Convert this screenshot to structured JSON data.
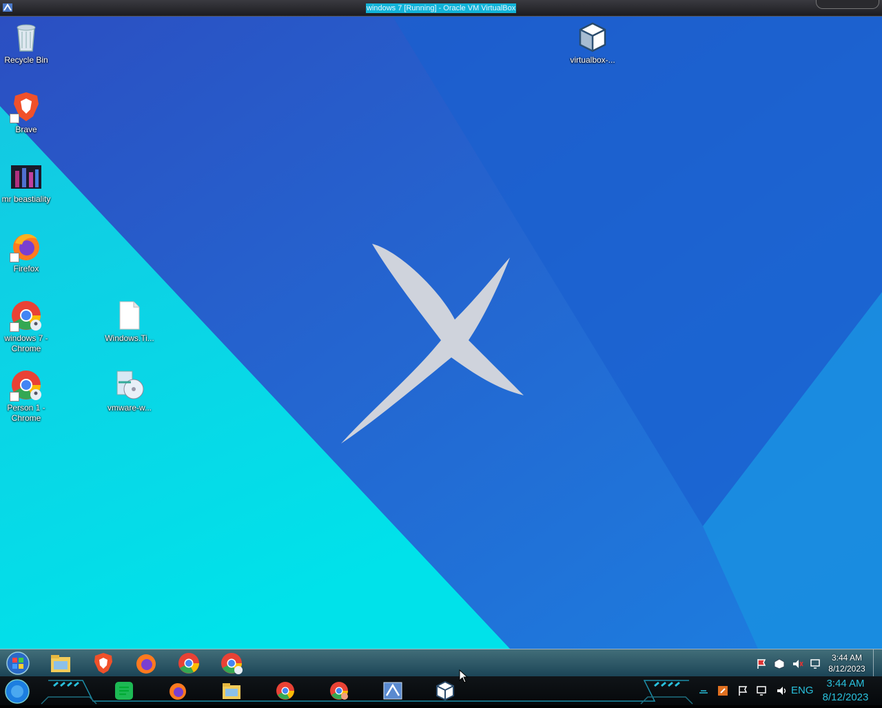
{
  "host": {
    "window_title": "windows 7 [Running] - Oracle VM VirtualBox",
    "taskbar": {
      "clock_time": "3:44 AM",
      "clock_date": "8/12/2023",
      "language": "ENG",
      "apps": [
        {
          "name": "notes",
          "icon": "green-notes-icon"
        },
        {
          "name": "firefox",
          "icon": "firefox-icon"
        },
        {
          "name": "file-explorer",
          "icon": "folder-icon"
        },
        {
          "name": "chrome",
          "icon": "chrome-icon"
        },
        {
          "name": "chrome-profile",
          "icon": "chrome-profile-icon"
        },
        {
          "name": "virtualbox-vm",
          "icon": "windows7-vm-icon"
        },
        {
          "name": "virtualbox",
          "icon": "virtualbox-icon"
        }
      ]
    }
  },
  "desktop": {
    "icons": [
      {
        "label": "Recycle Bin",
        "icon": "recycle-bin-icon"
      },
      {
        "label": "Brave",
        "icon": "brave-icon"
      },
      {
        "label": "mr beastiality",
        "icon": "image-thumbnail-icon"
      },
      {
        "label": "Firefox",
        "icon": "firefox-icon"
      },
      {
        "label": "windows 7 - Chrome",
        "icon": "chrome-profile-icon"
      },
      {
        "label": "Person 1 - Chrome",
        "icon": "chrome-profile-icon"
      },
      {
        "label": "Windows.Ti...",
        "icon": "blank-file-icon"
      },
      {
        "label": "vmware-w...",
        "icon": "installer-disc-icon"
      },
      {
        "label": "virtualbox-...",
        "icon": "virtualbox-icon"
      }
    ]
  },
  "guest_taskbar": {
    "clock_time": "3:44 AM",
    "clock_date": "8/12/2023",
    "pinned": [
      "File Explorer",
      "Brave",
      "Firefox",
      "Chrome",
      "Chrome Profile"
    ]
  },
  "colors": {
    "wallpaper_cyan": "#00d3e6",
    "wallpaper_blue": "#1e6fd6",
    "host_accent": "#29c0dc"
  }
}
